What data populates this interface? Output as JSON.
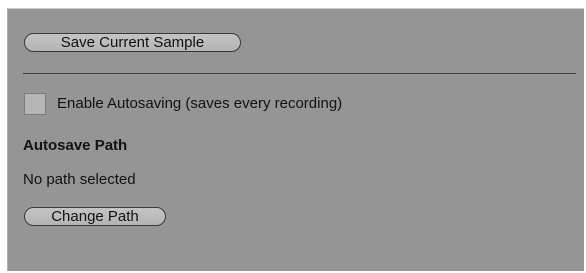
{
  "actions": {
    "save_current_sample": "Save Current Sample",
    "change_path": "Change Path"
  },
  "autosave": {
    "checkbox_label": "Enable Autosaving (saves every recording)",
    "checked": false
  },
  "path_section": {
    "heading": "Autosave Path",
    "value": "No path selected"
  }
}
